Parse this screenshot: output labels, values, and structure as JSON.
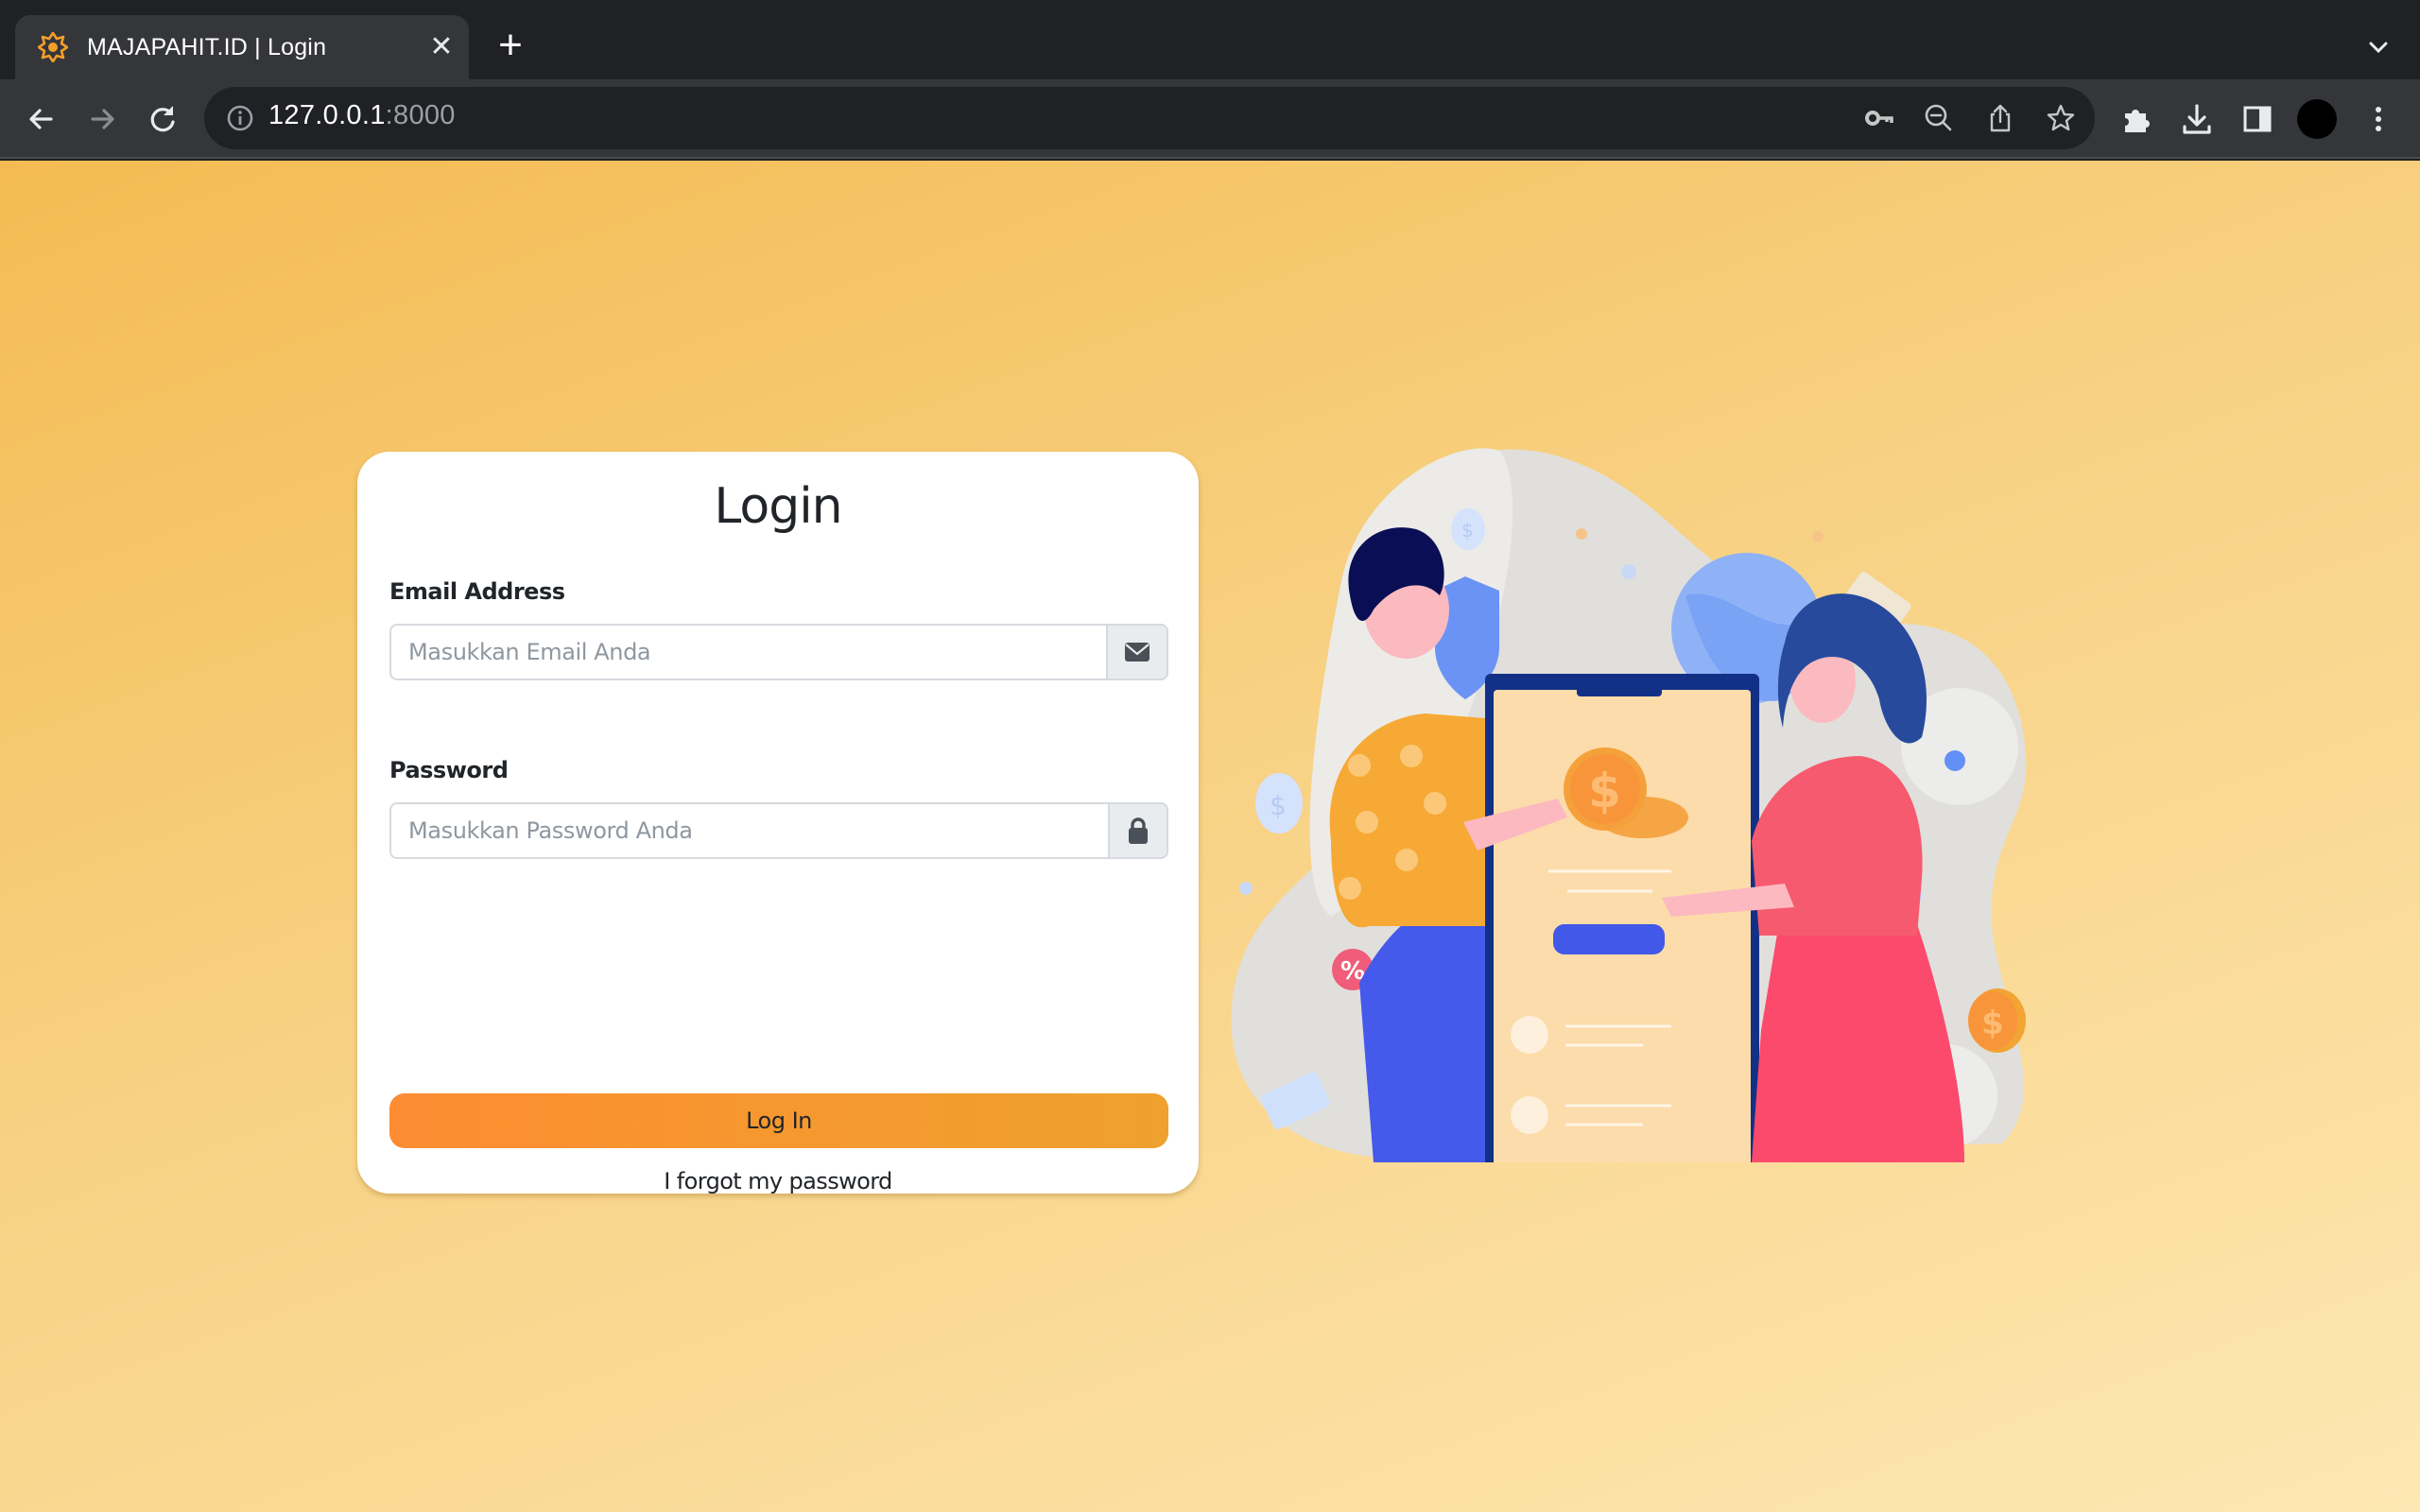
{
  "browser": {
    "tab": {
      "title": "MAJAPAHIT.ID | Login",
      "favicon": "majapahit-star-icon",
      "close_glyph": "✕"
    },
    "new_tab_glyph": "+",
    "address": {
      "host": "127.0.0.1",
      "port": ":8000"
    },
    "icons": [
      "back-icon",
      "forward-icon",
      "reload-icon",
      "info-icon",
      "key-icon",
      "zoom-out-icon",
      "share-icon",
      "bookmark-star-icon",
      "extensions-icon",
      "download-icon",
      "side-panel-icon",
      "profile-avatar",
      "menu-icon",
      "tab-search-icon"
    ]
  },
  "login": {
    "title": "Login",
    "email": {
      "label": "Email Address",
      "placeholder": "Masukkan Email Anda",
      "value": "",
      "icon": "envelope-icon"
    },
    "password": {
      "label": "Password",
      "placeholder": "Masukkan Password Anda",
      "value": "",
      "icon": "lock-icon"
    },
    "submit_label": "Log In",
    "forgot_label": "I forgot my password"
  },
  "illustration": {
    "subject": "two people with a large phone showing coins and payment UI"
  },
  "colors": {
    "bg_start": "#f4bb52",
    "bg_end": "#fde7b2",
    "button_start": "#fd8c32",
    "button_end": "#eea12e",
    "favicon": "#f29f2a"
  }
}
